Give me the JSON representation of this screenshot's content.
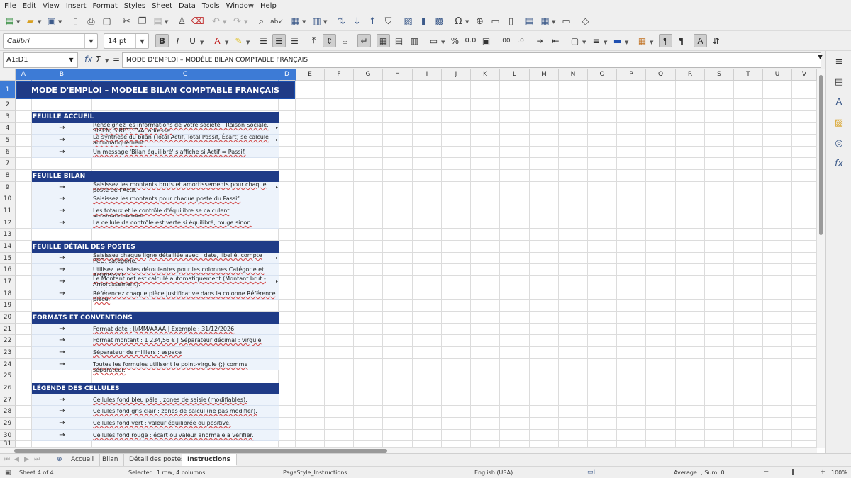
{
  "menu": [
    "File",
    "Edit",
    "View",
    "Insert",
    "Format",
    "Styles",
    "Sheet",
    "Data",
    "Tools",
    "Window",
    "Help"
  ],
  "font": {
    "name": "Calibri",
    "size": "14 pt"
  },
  "formula": {
    "cell_ref": "A1:D1",
    "content": "MODE D'EMPLOI – MODÈLE BILAN COMPTABLE FRANÇAIS"
  },
  "columns": [
    "A",
    "B",
    "C",
    "D",
    "E",
    "F",
    "G",
    "H",
    "I",
    "J",
    "K",
    "L",
    "M",
    "N",
    "O",
    "P",
    "Q",
    "R",
    "S",
    "T",
    "U",
    "V"
  ],
  "rows": [
    "1",
    "2",
    "3",
    "4",
    "5",
    "6",
    "7",
    "8",
    "9",
    "10",
    "11",
    "12",
    "13",
    "14",
    "15",
    "16",
    "17",
    "18",
    "19",
    "20",
    "21",
    "22",
    "23",
    "24",
    "25",
    "26",
    "27",
    "28",
    "29",
    "30",
    "31"
  ],
  "sheet": {
    "title": "MODE D'EMPLOI – MODÈLE BILAN COMPTABLE FRANÇAIS",
    "arrow": "→",
    "sections": [
      {
        "heading": "FEUILLE ACCUEIL",
        "items": [
          "Renseignez les informations de votre société : Raison Sociale, SIREN, SIRET, TVA, adresse.",
          "La synthèse du bilan (Total Actif, Total Passif, Écart) se calcule automatiquement.",
          "Un message 'Bilan équilibré' s'affiche si Actif = Passif."
        ]
      },
      {
        "heading": "FEUILLE BILAN",
        "items": [
          "Saisissez les montants bruts et amortissements pour chaque poste de l'Actif.",
          "Saisissez les montants pour chaque poste du Passif.",
          "Les totaux et le contrôle d'équilibre se calculent automatiquement.",
          "La cellule de contrôle est verte si équilibré, rouge sinon."
        ]
      },
      {
        "heading": "FEUILLE DÉTAIL DES POSTES",
        "items": [
          "Saisissez chaque ligne détaillée avec : date, libellé, compte PCG, catégorie.",
          "Utilisez les listes déroulantes pour les colonnes Catégorie et Actif/Passif.",
          "Le Montant net est calculé automatiquement (Montant brut - Amortissement).",
          "Référencez chaque pièce justificative dans la colonne Référence pièce."
        ]
      },
      {
        "heading": "FORMATS ET CONVENTIONS",
        "items": [
          "Format date : JJ/MM/AAAA  |  Exemple : 31/12/2026",
          "Format montant : 1 234,56 €  |  Séparateur décimal : virgule",
          "Séparateur de milliers : espace",
          "Toutes les formules utilisent le point-virgule (;) comme séparateur."
        ]
      },
      {
        "heading": "LÉGENDE DES CELLULES",
        "items": [
          "Cellules fond bleu pâle : zones de saisie (modifiables).",
          "Cellules fond gris clair : zones de calcul (ne pas modifier).",
          "Cellules fond vert : valeur équilibrée ou positive.",
          "Cellules fond rouge : écart ou valeur anormale à vérifier."
        ]
      }
    ]
  },
  "tabs": [
    "Accueil",
    "Bilan",
    "Détail des postes",
    "Instructions"
  ],
  "active_tab": "Instructions",
  "status": {
    "sheet": "Sheet 4 of 4",
    "selection": "Selected: 1 row, 4 columns",
    "page_style": "PageStyle_Instructions",
    "language": "English (USA)",
    "formula": "Average: ; Sum: 0",
    "zoom": "100%"
  },
  "colors": {
    "header_fill": "#1f3b87",
    "input_fill": "#edf3fb",
    "selection": "#3d7bd6"
  }
}
